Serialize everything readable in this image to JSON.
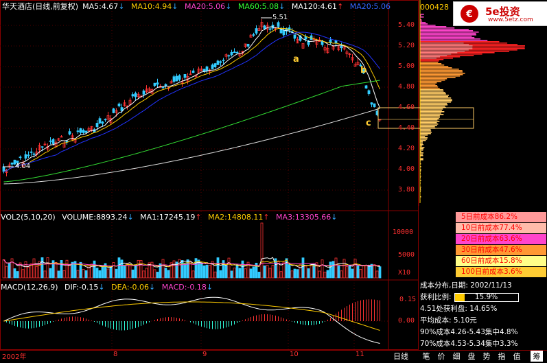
{
  "price_header": {
    "title": "华天酒店(日线,前复权)",
    "ma5": "MA5:4.67",
    "ma10": "MA10:4.94",
    "ma20": "MA20:5.06",
    "ma60": "MA60:5.08",
    "ma120": "MA120:4.61",
    "ma20b": "MA20:5.06"
  },
  "price_axis": [
    "5.40",
    "5.20",
    "5.00",
    "4.80",
    "4.60",
    "4.40",
    "4.20",
    "4.00",
    "3.80"
  ],
  "annotations": {
    "high": "5.51",
    "low": "4.04",
    "a": "a",
    "b": "b",
    "c": "c"
  },
  "volume_header": {
    "title": "VOL2(5,10,20)",
    "volume": "VOLUME:8893.24",
    "ma1": "MA1:17245.19",
    "ma2": "MA2:14808.11",
    "ma3": "MA3:13305.66"
  },
  "volume_axis": [
    "10000",
    "5000",
    "X10"
  ],
  "macd_header": {
    "title": "MACD(12,26,9)",
    "dif": "DIF:-0.15",
    "dea": "DEA:-0.06",
    "macd": "MACD:-0.18"
  },
  "macd_axis": [
    "0.15",
    "0.00"
  ],
  "months": [
    "2002年",
    "8",
    "9",
    "10",
    "11"
  ],
  "period_button": "日线",
  "side_tabs": [
    "笔",
    "价",
    "细",
    "盘",
    "势",
    "指",
    "值",
    "筹"
  ],
  "stock_code": "000428",
  "logo": {
    "name": "5e投资",
    "url": "www.5etz.com"
  },
  "cost_rows": [
    {
      "label": "5日前成本86.2%",
      "color": "#ff9999"
    },
    {
      "label": "10日前成本77.4%",
      "color": "#ffbbaa"
    },
    {
      "label": "20日前成本63.6%",
      "color": "#ff44cc"
    },
    {
      "label": "30日前成本47.6%",
      "color": "#ff9933"
    },
    {
      "label": "60日前成本15.8%",
      "color": "#ffff88"
    },
    {
      "label": "100日前成本3.6%",
      "color": "#ffcc33"
    }
  ],
  "info": {
    "date_line": "成本分布,日期: 2002/11/13",
    "profit_label": "获利比例:",
    "profit_value": "15.9%",
    "profit_ratio": 0.159,
    "profit_at": "4.51处获利盘: 14.65%",
    "avg_cost": "平均成本: 5.10元",
    "c90": "90%成本4.26-5.43集中4.8%",
    "c70": "70%成本4.53-5.34集中3.3%"
  }
}
